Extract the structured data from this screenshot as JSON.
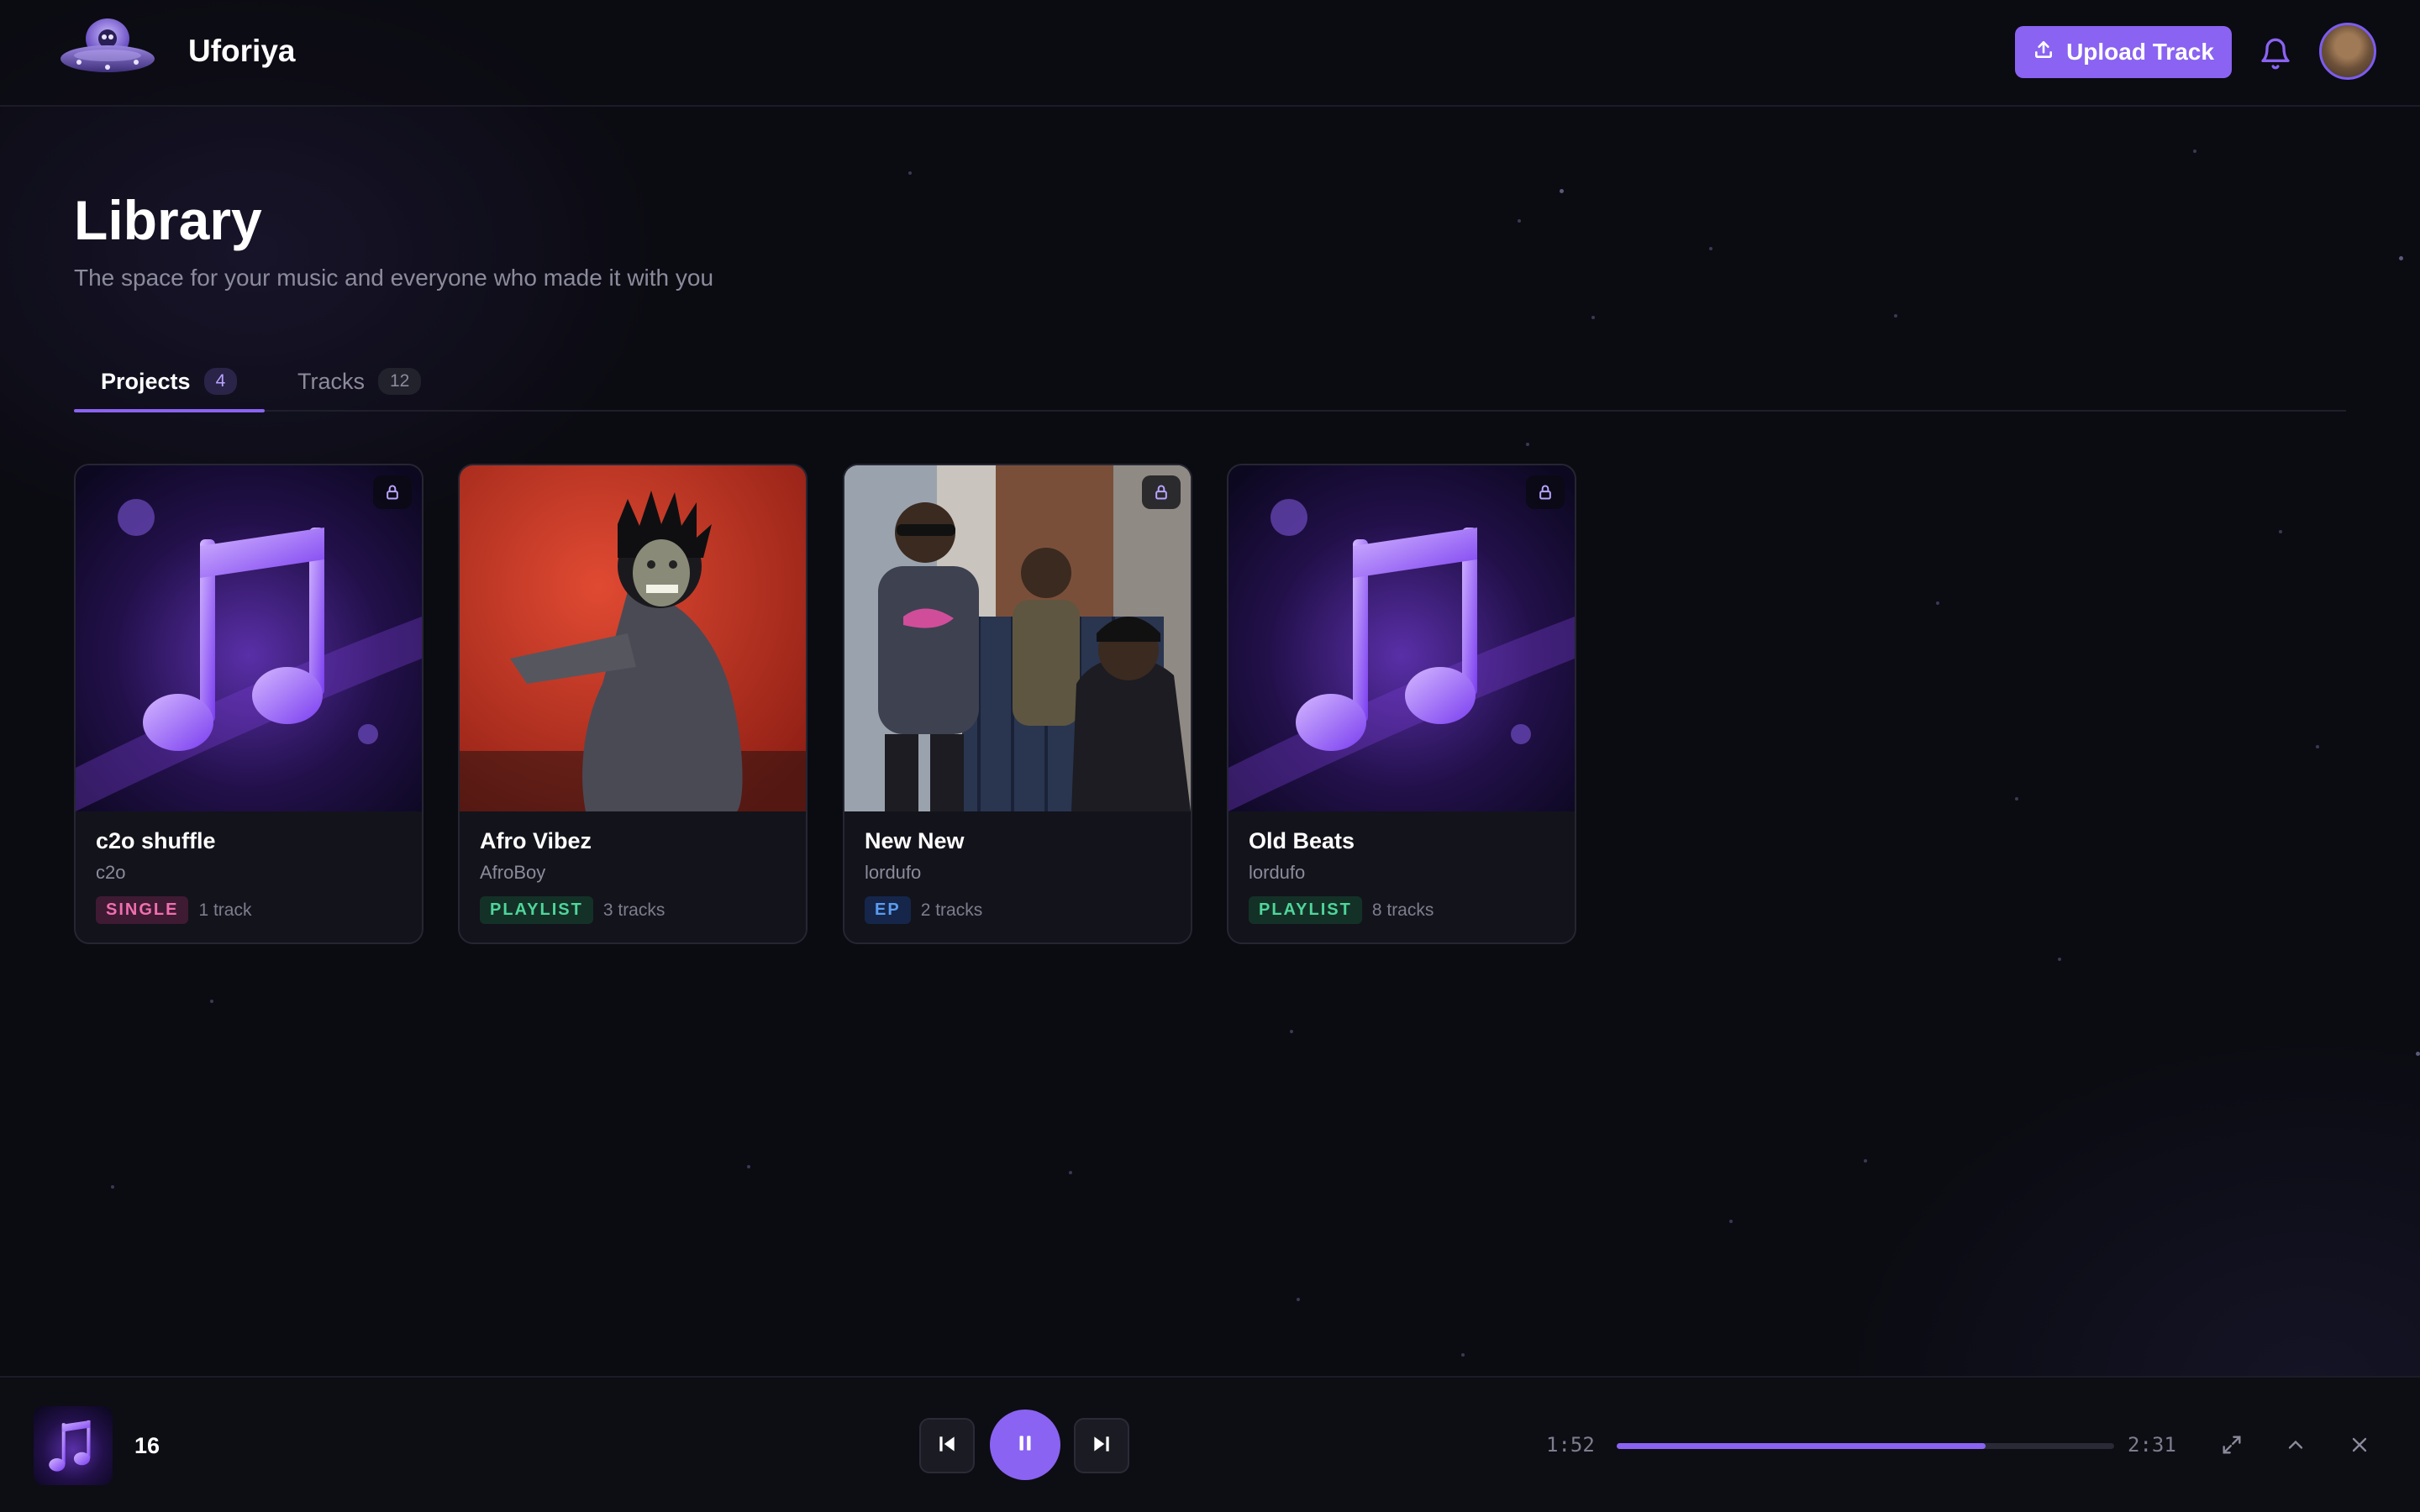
{
  "header": {
    "app_title": "Uforiya",
    "upload_label": "Upload Track",
    "logo_icon": "ufo-logo-icon",
    "notifications_icon": "bell-icon"
  },
  "page": {
    "title": "Library",
    "subtitle": "The space for your music and everyone who made it with you"
  },
  "tabs": [
    {
      "label": "Projects",
      "count": "4",
      "active": true
    },
    {
      "label": "Tracks",
      "count": "12",
      "active": false
    }
  ],
  "projects": [
    {
      "title": "c2o shuffle",
      "artist": "c2o",
      "type": "SINGLE",
      "tracks": "1 track",
      "locked": true
    },
    {
      "title": "Afro Vibez",
      "artist": "AfroBoy",
      "type": "PLAYLIST",
      "tracks": "3 tracks",
      "locked": false
    },
    {
      "title": "New New",
      "artist": "lordufo",
      "type": "EP",
      "tracks": "2 tracks",
      "locked": true
    },
    {
      "title": "Old Beats",
      "artist": "lordufo",
      "type": "PLAYLIST",
      "tracks": "8 tracks",
      "locked": true
    }
  ],
  "player": {
    "now_playing_title": "16",
    "elapsed": "1:52",
    "duration": "2:31",
    "progress": 0.742
  },
  "colors": {
    "accent": "#8a63f2",
    "background": "#0b0b12",
    "single_badge": "#f06fb0",
    "playlist_badge": "#4fd69a",
    "ep_badge": "#5b9cf0"
  }
}
